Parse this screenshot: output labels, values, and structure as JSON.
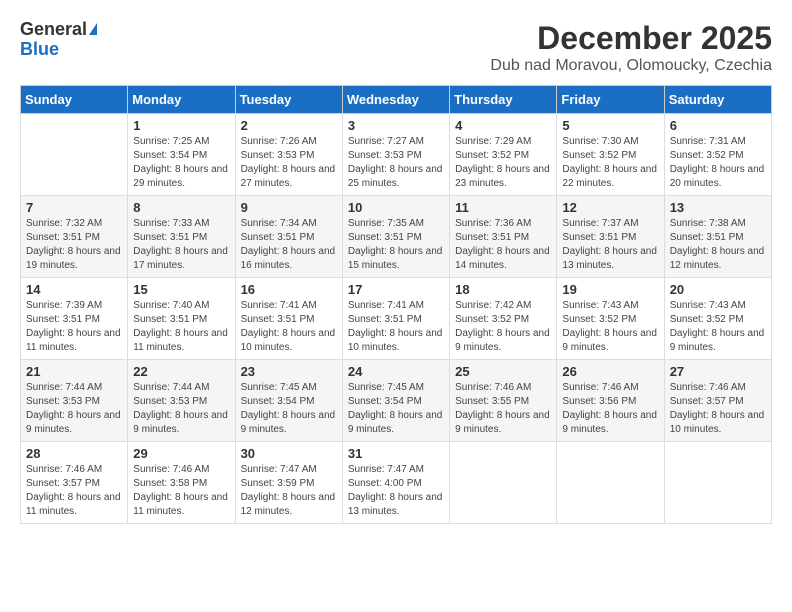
{
  "logo": {
    "general": "General",
    "blue": "Blue"
  },
  "title": "December 2025",
  "location": "Dub nad Moravou, Olomoucky, Czechia",
  "days": [
    "Sunday",
    "Monday",
    "Tuesday",
    "Wednesday",
    "Thursday",
    "Friday",
    "Saturday"
  ],
  "weeks": [
    [
      {
        "day": "",
        "sunrise": "",
        "sunset": "",
        "daylight": ""
      },
      {
        "day": "1",
        "sunrise": "Sunrise: 7:25 AM",
        "sunset": "Sunset: 3:54 PM",
        "daylight": "Daylight: 8 hours and 29 minutes."
      },
      {
        "day": "2",
        "sunrise": "Sunrise: 7:26 AM",
        "sunset": "Sunset: 3:53 PM",
        "daylight": "Daylight: 8 hours and 27 minutes."
      },
      {
        "day": "3",
        "sunrise": "Sunrise: 7:27 AM",
        "sunset": "Sunset: 3:53 PM",
        "daylight": "Daylight: 8 hours and 25 minutes."
      },
      {
        "day": "4",
        "sunrise": "Sunrise: 7:29 AM",
        "sunset": "Sunset: 3:52 PM",
        "daylight": "Daylight: 8 hours and 23 minutes."
      },
      {
        "day": "5",
        "sunrise": "Sunrise: 7:30 AM",
        "sunset": "Sunset: 3:52 PM",
        "daylight": "Daylight: 8 hours and 22 minutes."
      },
      {
        "day": "6",
        "sunrise": "Sunrise: 7:31 AM",
        "sunset": "Sunset: 3:52 PM",
        "daylight": "Daylight: 8 hours and 20 minutes."
      }
    ],
    [
      {
        "day": "7",
        "sunrise": "Sunrise: 7:32 AM",
        "sunset": "Sunset: 3:51 PM",
        "daylight": "Daylight: 8 hours and 19 minutes."
      },
      {
        "day": "8",
        "sunrise": "Sunrise: 7:33 AM",
        "sunset": "Sunset: 3:51 PM",
        "daylight": "Daylight: 8 hours and 17 minutes."
      },
      {
        "day": "9",
        "sunrise": "Sunrise: 7:34 AM",
        "sunset": "Sunset: 3:51 PM",
        "daylight": "Daylight: 8 hours and 16 minutes."
      },
      {
        "day": "10",
        "sunrise": "Sunrise: 7:35 AM",
        "sunset": "Sunset: 3:51 PM",
        "daylight": "Daylight: 8 hours and 15 minutes."
      },
      {
        "day": "11",
        "sunrise": "Sunrise: 7:36 AM",
        "sunset": "Sunset: 3:51 PM",
        "daylight": "Daylight: 8 hours and 14 minutes."
      },
      {
        "day": "12",
        "sunrise": "Sunrise: 7:37 AM",
        "sunset": "Sunset: 3:51 PM",
        "daylight": "Daylight: 8 hours and 13 minutes."
      },
      {
        "day": "13",
        "sunrise": "Sunrise: 7:38 AM",
        "sunset": "Sunset: 3:51 PM",
        "daylight": "Daylight: 8 hours and 12 minutes."
      }
    ],
    [
      {
        "day": "14",
        "sunrise": "Sunrise: 7:39 AM",
        "sunset": "Sunset: 3:51 PM",
        "daylight": "Daylight: 8 hours and 11 minutes."
      },
      {
        "day": "15",
        "sunrise": "Sunrise: 7:40 AM",
        "sunset": "Sunset: 3:51 PM",
        "daylight": "Daylight: 8 hours and 11 minutes."
      },
      {
        "day": "16",
        "sunrise": "Sunrise: 7:41 AM",
        "sunset": "Sunset: 3:51 PM",
        "daylight": "Daylight: 8 hours and 10 minutes."
      },
      {
        "day": "17",
        "sunrise": "Sunrise: 7:41 AM",
        "sunset": "Sunset: 3:51 PM",
        "daylight": "Daylight: 8 hours and 10 minutes."
      },
      {
        "day": "18",
        "sunrise": "Sunrise: 7:42 AM",
        "sunset": "Sunset: 3:52 PM",
        "daylight": "Daylight: 8 hours and 9 minutes."
      },
      {
        "day": "19",
        "sunrise": "Sunrise: 7:43 AM",
        "sunset": "Sunset: 3:52 PM",
        "daylight": "Daylight: 8 hours and 9 minutes."
      },
      {
        "day": "20",
        "sunrise": "Sunrise: 7:43 AM",
        "sunset": "Sunset: 3:52 PM",
        "daylight": "Daylight: 8 hours and 9 minutes."
      }
    ],
    [
      {
        "day": "21",
        "sunrise": "Sunrise: 7:44 AM",
        "sunset": "Sunset: 3:53 PM",
        "daylight": "Daylight: 8 hours and 9 minutes."
      },
      {
        "day": "22",
        "sunrise": "Sunrise: 7:44 AM",
        "sunset": "Sunset: 3:53 PM",
        "daylight": "Daylight: 8 hours and 9 minutes."
      },
      {
        "day": "23",
        "sunrise": "Sunrise: 7:45 AM",
        "sunset": "Sunset: 3:54 PM",
        "daylight": "Daylight: 8 hours and 9 minutes."
      },
      {
        "day": "24",
        "sunrise": "Sunrise: 7:45 AM",
        "sunset": "Sunset: 3:54 PM",
        "daylight": "Daylight: 8 hours and 9 minutes."
      },
      {
        "day": "25",
        "sunrise": "Sunrise: 7:46 AM",
        "sunset": "Sunset: 3:55 PM",
        "daylight": "Daylight: 8 hours and 9 minutes."
      },
      {
        "day": "26",
        "sunrise": "Sunrise: 7:46 AM",
        "sunset": "Sunset: 3:56 PM",
        "daylight": "Daylight: 8 hours and 9 minutes."
      },
      {
        "day": "27",
        "sunrise": "Sunrise: 7:46 AM",
        "sunset": "Sunset: 3:57 PM",
        "daylight": "Daylight: 8 hours and 10 minutes."
      }
    ],
    [
      {
        "day": "28",
        "sunrise": "Sunrise: 7:46 AM",
        "sunset": "Sunset: 3:57 PM",
        "daylight": "Daylight: 8 hours and 11 minutes."
      },
      {
        "day": "29",
        "sunrise": "Sunrise: 7:46 AM",
        "sunset": "Sunset: 3:58 PM",
        "daylight": "Daylight: 8 hours and 11 minutes."
      },
      {
        "day": "30",
        "sunrise": "Sunrise: 7:47 AM",
        "sunset": "Sunset: 3:59 PM",
        "daylight": "Daylight: 8 hours and 12 minutes."
      },
      {
        "day": "31",
        "sunrise": "Sunrise: 7:47 AM",
        "sunset": "Sunset: 4:00 PM",
        "daylight": "Daylight: 8 hours and 13 minutes."
      },
      {
        "day": "",
        "sunrise": "",
        "sunset": "",
        "daylight": ""
      },
      {
        "day": "",
        "sunrise": "",
        "sunset": "",
        "daylight": ""
      },
      {
        "day": "",
        "sunrise": "",
        "sunset": "",
        "daylight": ""
      }
    ]
  ]
}
